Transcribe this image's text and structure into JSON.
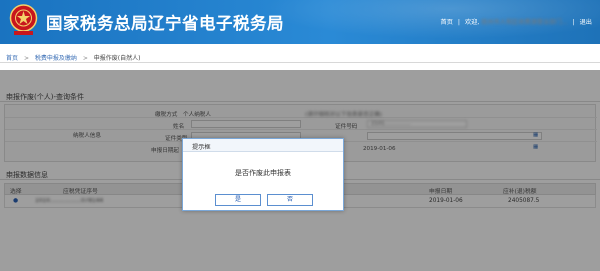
{
  "header": {
    "title": "国家税务总局辽宁省电子税务局",
    "nav_home": "首页",
    "nav_welcome": "欢迎,",
    "nav_user": "抚州市人和区收费源营业部门...",
    "nav_exit": "退出",
    "colors": {
      "header_bg": "#1a73c0",
      "logo_red": "#c8161d"
    }
  },
  "breadcrumb": {
    "home": "首页",
    "parent": "税费申报及缴纳",
    "current": "申报作废(自然人)"
  },
  "query_section": {
    "title": "申报作废(个人)-查询条件",
    "taxpayer_label": "纳税人信息",
    "person_type_label": "缴税方式",
    "person_type_value": "个人纳税人",
    "name_label": "姓名",
    "id_type_label": "证件类型",
    "id_number_label": "证件号码",
    "id_number_value": "2101...............",
    "tax_period_label": "申报日期起",
    "tax_period_value": "2019-01-06",
    "hint_text": "(请仔细核对以下信息是否正确)"
  },
  "data_section": {
    "title": "申报数据信息",
    "columns": [
      "选择",
      "应税凭证序号",
      "申报日期",
      "应补(退)税额"
    ],
    "rows": [
      {
        "select": "●",
        "seq": "1010.................078144",
        "date": "2019-01-06",
        "amount": "2405087.5"
      }
    ]
  },
  "dialog": {
    "title": "提示框",
    "message": "是否作废此申报表",
    "yes": "是",
    "no": "否"
  }
}
